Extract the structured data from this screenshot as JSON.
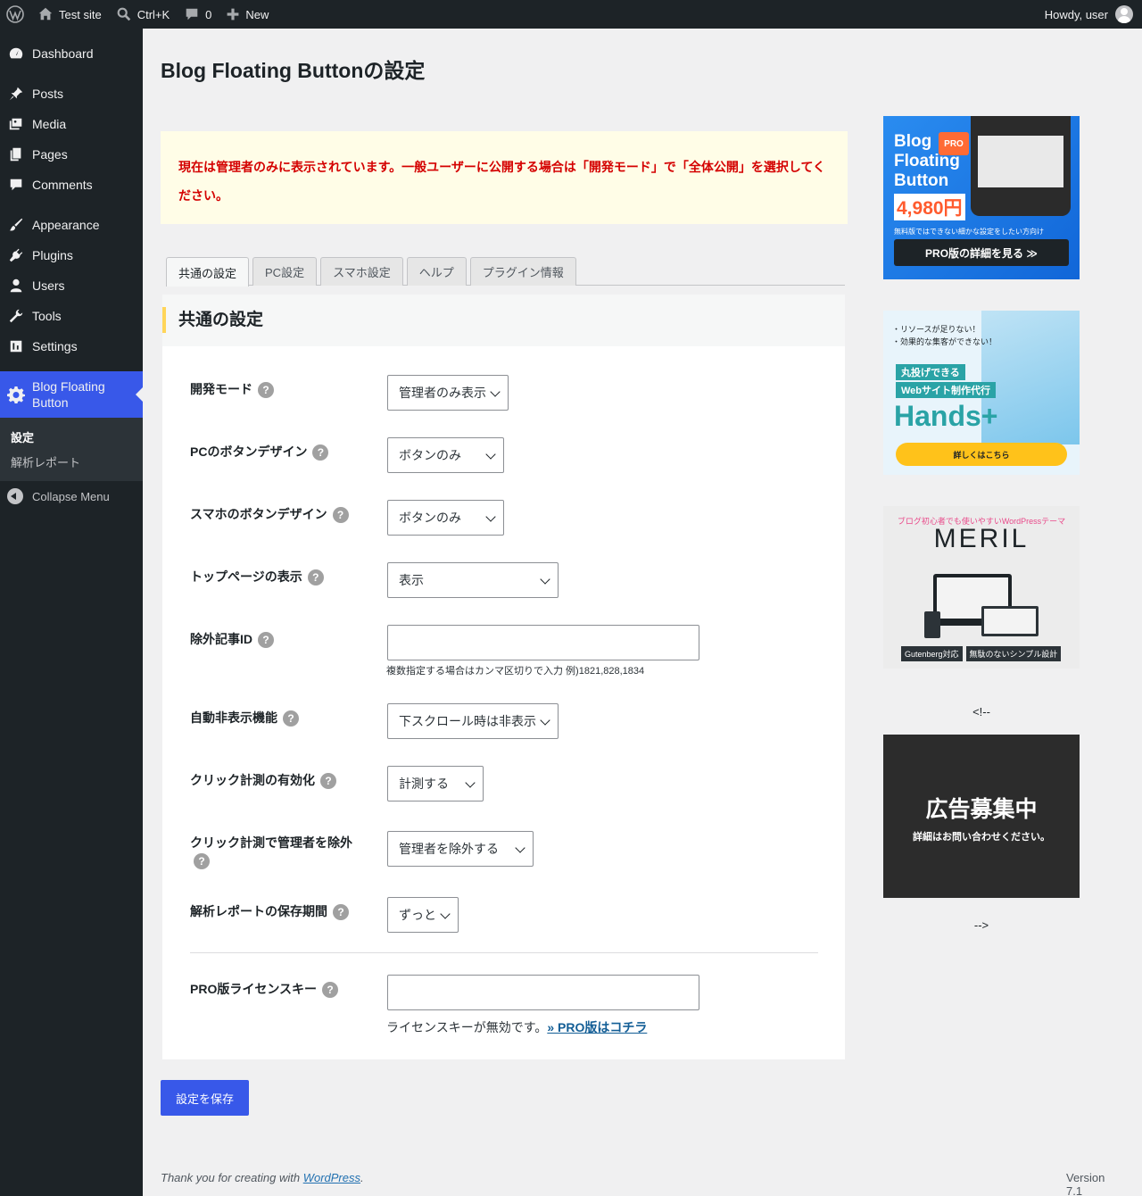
{
  "adminbar": {
    "site_name": "Test site",
    "search_shortcut": "Ctrl+K",
    "comments_count": "0",
    "new_label": "New",
    "howdy": "Howdy, user"
  },
  "sidebar": {
    "items": [
      {
        "label": "Dashboard",
        "icon": "dashboard-icon"
      },
      {
        "label": "Posts",
        "icon": "pin-icon"
      },
      {
        "label": "Media",
        "icon": "media-icon"
      },
      {
        "label": "Pages",
        "icon": "pages-icon"
      },
      {
        "label": "Comments",
        "icon": "comment-icon"
      },
      {
        "label": "Appearance",
        "icon": "brush-icon"
      },
      {
        "label": "Plugins",
        "icon": "plugin-icon"
      },
      {
        "label": "Users",
        "icon": "user-icon"
      },
      {
        "label": "Tools",
        "icon": "wrench-icon"
      },
      {
        "label": "Settings",
        "icon": "settings-icon"
      },
      {
        "label": "Blog Floating Button",
        "icon": "gear-icon"
      }
    ],
    "submenu": [
      "設定",
      "解析レポート"
    ],
    "collapse": "Collapse Menu"
  },
  "page": {
    "title": "Blog Floating Buttonの設定",
    "notice": "現在は管理者のみに表示されています。一般ユーザーに公開する場合は「開発モード」で「全体公開」を選択してください。",
    "tabs": [
      "共通の設定",
      "PC設定",
      "スマホ設定",
      "ヘルプ",
      "プラグイン情報"
    ],
    "section_title": "共通の設定",
    "help_glyph": "?",
    "fields": {
      "dev_mode": {
        "label": "開発モード",
        "value": "管理者のみ表示"
      },
      "pc_design": {
        "label": "PCのボタンデザイン",
        "value": "ボタンのみ"
      },
      "sp_design": {
        "label": "スマホのボタンデザイン",
        "value": "ボタンのみ"
      },
      "top_page": {
        "label": "トップページの表示",
        "value": "表示"
      },
      "exclude_ids": {
        "label": "除外記事ID",
        "value": "",
        "description": "複数指定する場合はカンマ区切りで入力 例)1821,828,1834"
      },
      "auto_hide": {
        "label": "自動非表示機能",
        "value": "下スクロール時は非表示"
      },
      "click_tracking": {
        "label": "クリック計測の有効化",
        "value": "計測する"
      },
      "exclude_admin": {
        "label": "クリック計測で管理者を除外",
        "value": "管理者を除外する"
      },
      "report_period": {
        "label": "解析レポートの保存期間",
        "value": "ずっと"
      },
      "license_key": {
        "label": "PRO版ライセンスキー",
        "value": "",
        "description": "ライセンスキーが無効です。",
        "link": "» PRO版はコチラ"
      }
    },
    "save_button": "設定を保存"
  },
  "ads": {
    "ad1": {
      "line1": "Blog",
      "line2": "Floating",
      "line3": "Button",
      "pro_badge": "PRO",
      "price": "4,980円",
      "sub": "無料版ではできない細かな設定をしたい方向け",
      "button": "PRO版の詳細を見る ≫"
    },
    "ad2": {
      "line1": "・リソースが足りない！",
      "line2": "・効果的な集客ができない！",
      "tag1": "丸投げできる",
      "tag2": "Webサイト制作代行",
      "brand": "Hands+",
      "button": "詳しくはこちら"
    },
    "ad3": {
      "tagline": "ブログ初心者でも使いやすいWordPressテーマ",
      "brand": "MERIL",
      "chip1": "Gutenberg対応",
      "chip2": "無駄のないシンプル設計"
    },
    "comment_open": "<!--",
    "ad4": {
      "big": "広告募集中",
      "small": "詳細はお問い合わせください。"
    },
    "comment_close": "-->"
  },
  "footer": {
    "thanks_prefix": "Thank you for creating with ",
    "wp_link": "WordPress",
    "thanks_suffix": ".",
    "version": "Version 7.1"
  }
}
